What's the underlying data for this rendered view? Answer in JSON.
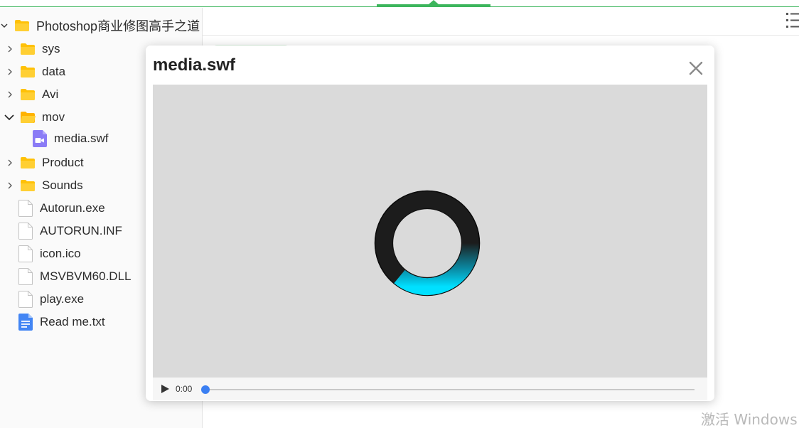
{
  "tree": {
    "root": {
      "label": "Photoshop商业修图高手之道",
      "expanded": true
    },
    "items": [
      {
        "type": "folder",
        "label": "sys",
        "expanded": false
      },
      {
        "type": "folder",
        "label": "data",
        "expanded": false
      },
      {
        "type": "folder",
        "label": "Avi",
        "expanded": false
      },
      {
        "type": "folder",
        "label": "mov",
        "expanded": true
      },
      {
        "type": "video-file",
        "label": "media.swf"
      },
      {
        "type": "folder",
        "label": "Product",
        "expanded": false
      },
      {
        "type": "folder",
        "label": "Sounds",
        "expanded": false
      },
      {
        "type": "file",
        "label": "Autorun.exe"
      },
      {
        "type": "file",
        "label": "AUTORUN.INF"
      },
      {
        "type": "file",
        "label": "icon.ico"
      },
      {
        "type": "file",
        "label": "MSVBVM60.DLL"
      },
      {
        "type": "file",
        "label": "play.exe"
      },
      {
        "type": "text-file",
        "label": "Read me.txt"
      }
    ]
  },
  "modal": {
    "title": "media.swf",
    "player": {
      "time": "0:00",
      "progress": 0
    }
  },
  "watermark": "激活 Windows",
  "colors": {
    "accent": "#3cb55c",
    "folder": "#ffc107",
    "video_icon": "#8b7cf6",
    "text_icon": "#4285f4",
    "seek_knob": "#3b7ff2",
    "loader_glow": "#00d8ff"
  }
}
